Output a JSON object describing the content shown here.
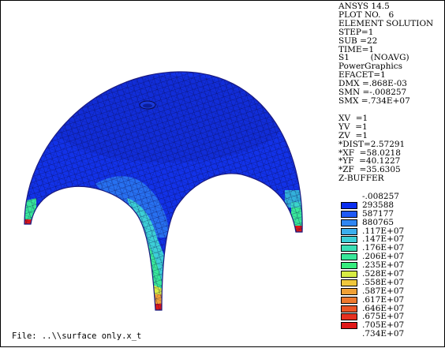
{
  "header": {
    "lines": [
      "ANSYS 14.5",
      "PLOT NO.   6",
      "ELEMENT SOLUTION",
      "STEP=1",
      "SUB =22",
      "TIME=1",
      "S1        (NOAVG)",
      "PowerGraphics",
      "EFACET=1",
      "DMX =.868E-03",
      "SMN =-.008257",
      "SMX =.734E+07"
    ]
  },
  "view": {
    "lines": [
      "XV  =1",
      "YV  =1",
      "ZV  =1",
      "*DIST=2.57291",
      "*XF  =58.0218",
      "*YF  =40.1227",
      "*ZF  =35.6305",
      "Z-BUFFER"
    ]
  },
  "legend": {
    "items": [
      {
        "value": "-.008257",
        "color": ""
      },
      {
        "value": "293588",
        "color": "#0a2ef0"
      },
      {
        "value": "587177",
        "color": "#1f5af5"
      },
      {
        "value": "880765",
        "color": "#2f86f3"
      },
      {
        "value": ".117E+07",
        "color": "#3aaeee"
      },
      {
        "value": ".147E+07",
        "color": "#3ccfd7"
      },
      {
        "value": ".176E+07",
        "color": "#39dfb5"
      },
      {
        "value": ".206E+07",
        "color": "#38e79a"
      },
      {
        "value": ".235E+07",
        "color": "#36ec7d"
      },
      {
        "value": ".528E+07",
        "color": "#d8ec44"
      },
      {
        "value": ".558E+07",
        "color": "#f0c83c"
      },
      {
        "value": ".587E+07",
        "color": "#f0a035"
      },
      {
        "value": ".617E+07",
        "color": "#ef7a2e"
      },
      {
        "value": ".646E+07",
        "color": "#ec5626"
      },
      {
        "value": ".675E+07",
        "color": "#e6301f"
      },
      {
        "value": ".705E+07",
        "color": "#e01818"
      },
      {
        "value": ".734E+07",
        "color": ""
      }
    ]
  },
  "footer": {
    "file_label": "File: ..\\\\surface only.x_t"
  },
  "colors": {
    "shell_blue": "#1232e8",
    "shell_edge": "#1a1a80",
    "mesh": "#0a0a4a",
    "cyan": "#3ccfd7",
    "green": "#38e79a",
    "yellow": "#d8ec44",
    "orange": "#f0a035",
    "red": "#e01818"
  }
}
